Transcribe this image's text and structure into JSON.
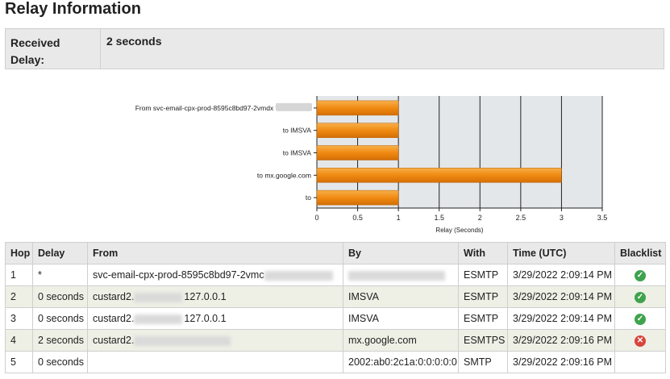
{
  "page": {
    "title": "Relay Information"
  },
  "summary": {
    "label": "Received Delay:",
    "value": "2 seconds"
  },
  "chart_data": {
    "type": "bar",
    "orientation": "horizontal",
    "categories": [
      "From svc-email-cpx-prod-8595c8bd97-2vmdx to custard2.",
      "to IMSVA",
      "to IMSVA",
      "to mx.google.com",
      "to"
    ],
    "values": [
      1,
      1,
      1,
      3,
      1
    ],
    "xlabel": "Relay (Seconds)",
    "xlim": [
      0,
      3.5
    ],
    "xticks": [
      "0",
      "0.5",
      "1",
      "1.5",
      "2",
      "2.5",
      "3",
      "3.5"
    ],
    "grid": true,
    "bar_color": "#f08a12"
  },
  "table": {
    "headers": [
      "Hop",
      "Delay",
      "From",
      "By",
      "With",
      "Time (UTC)",
      "Blacklist"
    ],
    "rows": [
      {
        "hop": "1",
        "delay": "*",
        "from": "svc-email-cpx-prod-8595c8bd97-2vmc",
        "by": "",
        "with": "ESMTP",
        "time": "3/29/2022 2:09:14 PM",
        "blacklist": "ok-icon"
      },
      {
        "hop": "2",
        "delay": "0 seconds",
        "from": "custard2.",
        "from_tail": "127.0.0.1",
        "by": "IMSVA",
        "with": "ESMTP",
        "time": "3/29/2022 2:09:14 PM",
        "blacklist": "ok-icon"
      },
      {
        "hop": "3",
        "delay": "0 seconds",
        "from": "custard2.",
        "from_tail": "127.0.0.1",
        "by": "IMSVA",
        "with": "ESMTP",
        "time": "3/29/2022 2:09:14 PM",
        "blacklist": "ok-icon"
      },
      {
        "hop": "4",
        "delay": "2 seconds",
        "from": "custard2.",
        "by": "mx.google.com",
        "with": "ESMTPS",
        "time": "3/29/2022 2:09:16 PM",
        "blacklist": "blocked-icon"
      },
      {
        "hop": "5",
        "delay": "0 seconds",
        "from": "",
        "by": "2002:ab0:2c1a:0:0:0:0:0",
        "with": "SMTP",
        "time": "3/29/2022 2:09:16 PM",
        "blacklist": ""
      }
    ]
  },
  "icons": {
    "ok_color": "#3fa34d",
    "bad_color": "#d9453d"
  }
}
